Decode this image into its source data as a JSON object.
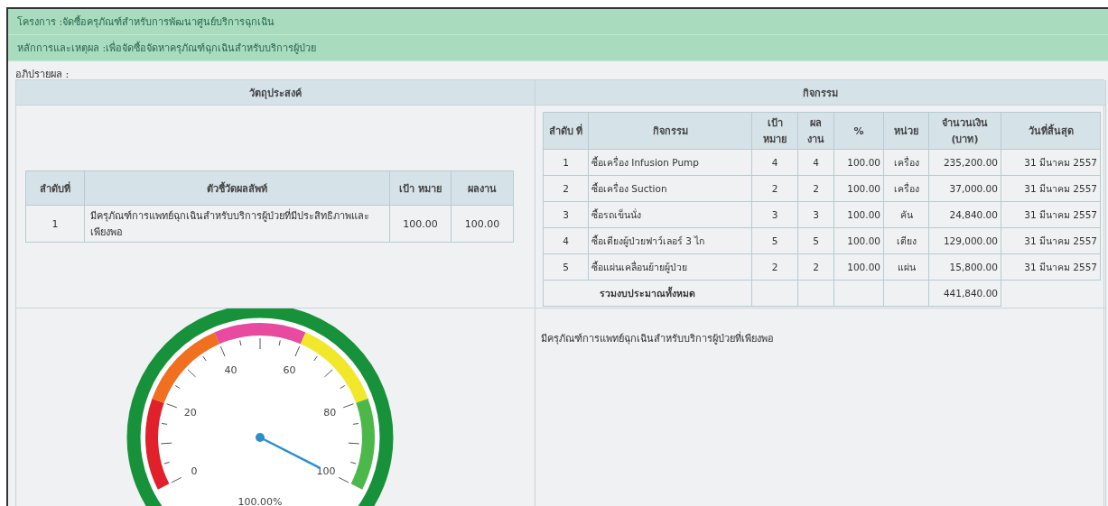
{
  "project": {
    "label": "โครงการ :",
    "value": "จัดซื้อครุภัณฑ์สำหรับการพัฒนาศูนย์บริการฉุกเฉิน"
  },
  "rationale": {
    "label": "หลักการและเหตุผล :",
    "value": "เพื่อจัดซื้อจัดหาครุภัณฑ์ฉุกเฉินสำหรับบริการผู้ป่วย"
  },
  "discussion_label": "อภิปรายผล :",
  "objectives": {
    "heading": "วัตถุประสงค์",
    "columns": [
      "ลำดับที่",
      "ตัวชี้วัดผลลัพท์",
      "เป้า หมาย",
      "ผลงาน"
    ],
    "rows": [
      {
        "no": "1",
        "indicator": "มีครุภัณฑ์การแพทย์ฉุกเฉินสำหรับบริการผู้ป่วยที่มีประสิทธิภาพและเพียงพอ",
        "target": "100.00",
        "result": "100.00"
      }
    ]
  },
  "activities": {
    "heading": "กิจกรรม",
    "columns": [
      "ลำดับ ที่",
      "กิจกรรม",
      "เป้า หมาย",
      "ผล งาน",
      "%",
      "หน่วย",
      "จำนวนเงิน (บาท)",
      "วันที่สิ้นสุด"
    ],
    "rows": [
      {
        "no": "1",
        "activity": "ซื้อเครื่อง Infusion Pump",
        "target": "4",
        "result": "4",
        "percent": "100.00",
        "unit": "เครื่อง",
        "amount": "235,200.00",
        "end_date": "31 มีนาคม 2557"
      },
      {
        "no": "2",
        "activity": "ซื้อเครื่อง Suction",
        "target": "2",
        "result": "2",
        "percent": "100.00",
        "unit": "เครื่อง",
        "amount": "37,000.00",
        "end_date": "31 มีนาคม 2557"
      },
      {
        "no": "3",
        "activity": "ซื้อรถเข็นนั่ง",
        "target": "3",
        "result": "3",
        "percent": "100.00",
        "unit": "คัน",
        "amount": "24,840.00",
        "end_date": "31 มีนาคม 2557"
      },
      {
        "no": "4",
        "activity": "ซื้อเตียงผู้ป่วยฟาว์เลอร์ 3 ไก",
        "target": "5",
        "result": "5",
        "percent": "100.00",
        "unit": "เตียง",
        "amount": "129,000.00",
        "end_date": "31 มีนาคม 2557"
      },
      {
        "no": "5",
        "activity": "ซื้อแผ่นเคลื่อนย้ายผู้ป่วย",
        "target": "2",
        "result": "2",
        "percent": "100.00",
        "unit": "แผ่น",
        "amount": "15,800.00",
        "end_date": "31 มีนาคม 2557"
      }
    ],
    "total_label": "รวมงบประมาณทั้งหมด",
    "total_amount": "441,840.00"
  },
  "gauge": {
    "ticks": [
      "0",
      "20",
      "40",
      "60",
      "80",
      "100"
    ],
    "level": 1,
    "reading": "100.00%"
  },
  "summary": "มีครุภัณฑ์การแพทย์ฉุกเฉินสำหรับบริการผู้ป่วยที่เพียงพอ"
}
